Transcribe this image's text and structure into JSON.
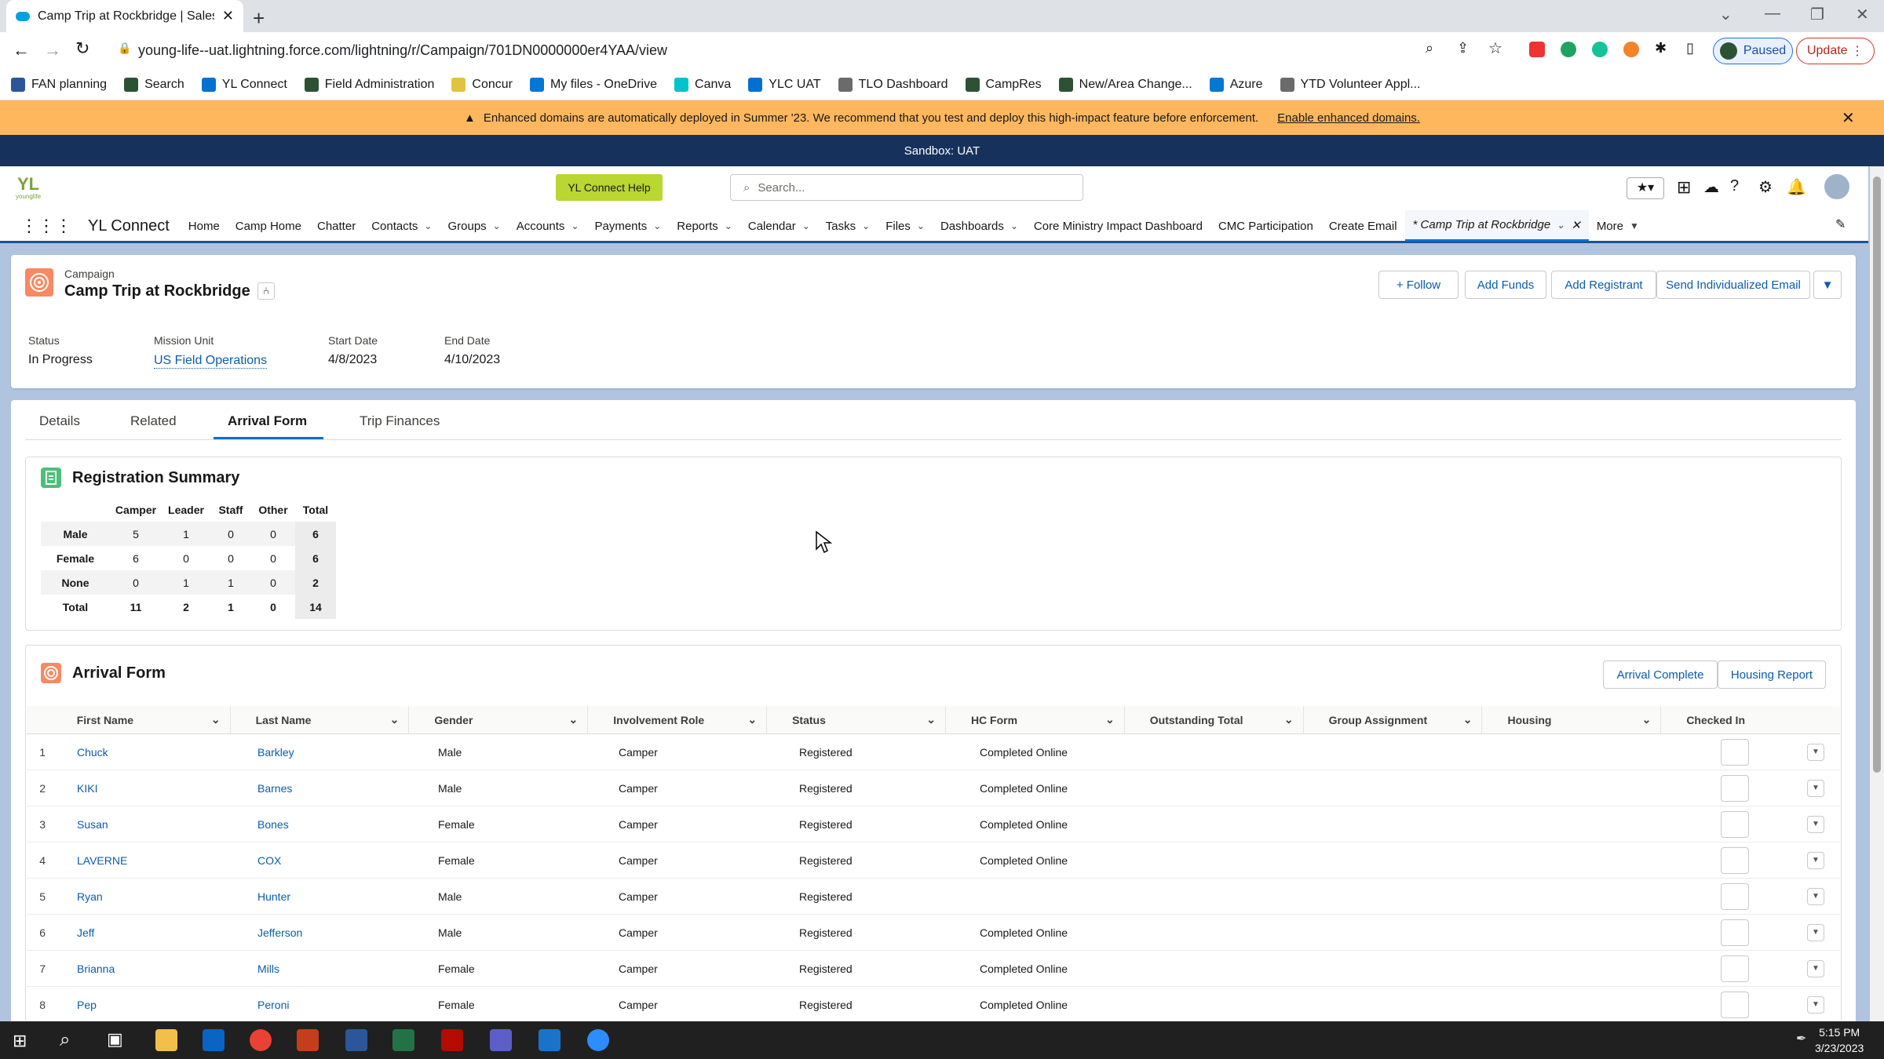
{
  "browser": {
    "tab_title": "Camp Trip at Rockbridge | Salesf",
    "url": "young-life--uat.lightning.force.com/lightning/r/Campaign/701DN0000000er4YAA/view",
    "paused_label": "Paused",
    "update_label": "Update"
  },
  "bookmarks": [
    {
      "label": "FAN planning",
      "color": "#2b579a"
    },
    {
      "label": "Search",
      "color": "#2c5234"
    },
    {
      "label": "YL Connect",
      "color": "#0070d2"
    },
    {
      "label": "Field Administration",
      "color": "#2c5234"
    },
    {
      "label": "Concur",
      "color": "#e0c341"
    },
    {
      "label": "My files - OneDrive",
      "color": "#0078d4"
    },
    {
      "label": "Canva",
      "color": "#00c4cc"
    },
    {
      "label": "YLC UAT",
      "color": "#0070d2"
    },
    {
      "label": "TLO Dashboard",
      "color": "#6b6b6b"
    },
    {
      "label": "CampRes",
      "color": "#2c5234"
    },
    {
      "label": "New/Area Change...",
      "color": "#2c5234"
    },
    {
      "label": "Azure",
      "color": "#0078d4"
    },
    {
      "label": "YTD Volunteer Appl...",
      "color": "#6b6b6b"
    }
  ],
  "banner": {
    "text": "Enhanced domains are automatically deployed in Summer '23. We recommend that you test and deploy this high-impact feature before enforcement.",
    "link": "Enable enhanced domains."
  },
  "sandbox": "Sandbox: UAT",
  "header": {
    "help_label": "YL Connect Help",
    "search_placeholder": "Search...",
    "app_name": "YL Connect"
  },
  "nav": [
    {
      "label": "Home",
      "dd": false
    },
    {
      "label": "Camp Home",
      "dd": false
    },
    {
      "label": "Chatter",
      "dd": false
    },
    {
      "label": "Contacts",
      "dd": true
    },
    {
      "label": "Groups",
      "dd": true
    },
    {
      "label": "Accounts",
      "dd": true
    },
    {
      "label": "Payments",
      "dd": true
    },
    {
      "label": "Reports",
      "dd": true
    },
    {
      "label": "Calendar",
      "dd": true
    },
    {
      "label": "Tasks",
      "dd": true
    },
    {
      "label": "Files",
      "dd": true
    },
    {
      "label": "Dashboards",
      "dd": true
    },
    {
      "label": "Core Ministry Impact Dashboard",
      "dd": false
    },
    {
      "label": "CMC Participation",
      "dd": false
    },
    {
      "label": "Create Email",
      "dd": false
    }
  ],
  "nav_current": "* Camp Trip at Rockbridge",
  "nav_more": "More",
  "record": {
    "type": "Campaign",
    "name": "Camp Trip at Rockbridge",
    "actions": {
      "follow": "Follow",
      "add_funds": "Add Funds",
      "add_registrant": "Add Registrant",
      "send_email": "Send Individualized Email"
    },
    "fields": {
      "status_label": "Status",
      "status": "In Progress",
      "mission_label": "Mission Unit",
      "mission": "US Field Operations",
      "start_label": "Start Date",
      "start": "4/8/2023",
      "end_label": "End Date",
      "end": "4/10/2023"
    }
  },
  "tabs": [
    "Details",
    "Related",
    "Arrival Form",
    "Trip Finances"
  ],
  "summary": {
    "title": "Registration Summary",
    "columns": [
      "Camper",
      "Leader",
      "Staff",
      "Other",
      "Total"
    ],
    "rows": [
      {
        "label": "Male",
        "values": [
          "5",
          "1",
          "0",
          "0",
          "6"
        ]
      },
      {
        "label": "Female",
        "values": [
          "6",
          "0",
          "0",
          "0",
          "6"
        ]
      },
      {
        "label": "None",
        "values": [
          "0",
          "1",
          "1",
          "0",
          "2"
        ]
      },
      {
        "label": "Total",
        "values": [
          "11",
          "2",
          "1",
          "0",
          "14"
        ]
      }
    ]
  },
  "arrival": {
    "title": "Arrival Form",
    "btn_complete": "Arrival Complete",
    "btn_housing": "Housing Report",
    "columns": [
      "First Name",
      "Last Name",
      "Gender",
      "Involvement Role",
      "Status",
      "HC Form",
      "Outstanding Total",
      "Group Assignment",
      "Housing",
      "Checked In"
    ],
    "rows": [
      {
        "n": "1",
        "first": "Chuck",
        "last": "Barkley",
        "gender": "Male",
        "role": "Camper",
        "status": "Registered",
        "hc": "Completed Online"
      },
      {
        "n": "2",
        "first": "KIKI",
        "last": "Barnes",
        "gender": "Male",
        "role": "Camper",
        "status": "Registered",
        "hc": "Completed Online"
      },
      {
        "n": "3",
        "first": "Susan",
        "last": "Bones",
        "gender": "Female",
        "role": "Camper",
        "status": "Registered",
        "hc": "Completed Online"
      },
      {
        "n": "4",
        "first": "LAVERNE",
        "last": "COX",
        "gender": "Female",
        "role": "Camper",
        "status": "Registered",
        "hc": "Completed Online"
      },
      {
        "n": "5",
        "first": "Ryan",
        "last": "Hunter",
        "gender": "Male",
        "role": "Camper",
        "status": "Registered",
        "hc": ""
      },
      {
        "n": "6",
        "first": "Jeff",
        "last": "Jefferson",
        "gender": "Male",
        "role": "Camper",
        "status": "Registered",
        "hc": "Completed Online"
      },
      {
        "n": "7",
        "first": "Brianna",
        "last": "Mills",
        "gender": "Female",
        "role": "Camper",
        "status": "Registered",
        "hc": "Completed Online"
      },
      {
        "n": "8",
        "first": "Pep",
        "last": "Peroni",
        "gender": "Female",
        "role": "Camper",
        "status": "Registered",
        "hc": "Completed Online"
      }
    ]
  },
  "clock": {
    "time": "5:15 PM",
    "date": "3/23/2023"
  },
  "colors": {
    "nav_accent": "#1b5297",
    "warning": "#ffb75d",
    "link": "#0b5cab",
    "help_btn": "#b9d631",
    "campaign_icon": "#f88962"
  }
}
